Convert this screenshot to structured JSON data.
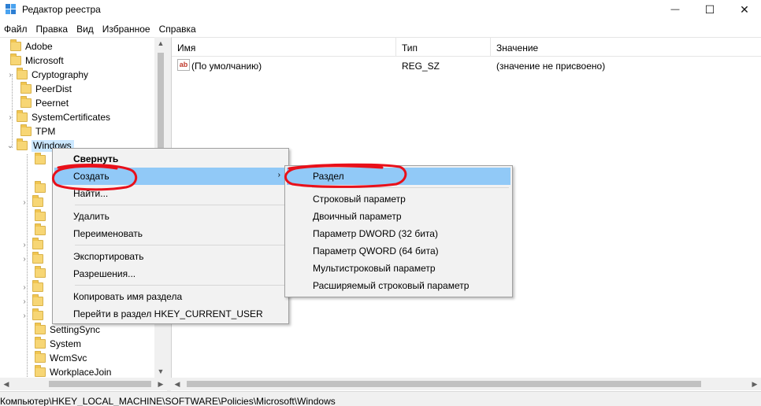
{
  "window": {
    "title": "Редактор реестра",
    "controls": {
      "minimize": "—",
      "maximize": "☐",
      "close": "✕"
    }
  },
  "menubar": [
    "Файл",
    "Правка",
    "Вид",
    "Избранное",
    "Справка"
  ],
  "tree": {
    "items": [
      {
        "label": "Adobe",
        "expander": ""
      },
      {
        "label": "Microsoft",
        "expander": ""
      },
      {
        "label": "Cryptography",
        "expander": "›"
      },
      {
        "label": "PeerDist",
        "expander": ""
      },
      {
        "label": "Peernet",
        "expander": ""
      },
      {
        "label": "SystemCertificates",
        "expander": "›"
      },
      {
        "label": "TPM",
        "expander": ""
      },
      {
        "label": "Windows",
        "expander": "⌄"
      },
      {
        "label": "SettingSync",
        "expander": ""
      },
      {
        "label": "System",
        "expander": ""
      },
      {
        "label": "WcmSvc",
        "expander": ""
      },
      {
        "label": "WorkplaceJoin",
        "expander": ""
      }
    ]
  },
  "list": {
    "columns": [
      "Имя",
      "Тип",
      "Значение"
    ],
    "rows": [
      {
        "icon": "ab",
        "name": "(По умолчанию)",
        "type": "REG_SZ",
        "value": "(значение не присвоено)"
      }
    ]
  },
  "context_menu": {
    "items": [
      {
        "label": "Свернуть"
      },
      {
        "label": "Создать",
        "submenu_arrow": "›"
      },
      {
        "label": "Найти..."
      },
      {
        "label": "Удалить"
      },
      {
        "label": "Переименовать"
      },
      {
        "label": "Экспортировать"
      },
      {
        "label": "Разрешения..."
      },
      {
        "label": "Копировать имя раздела"
      },
      {
        "label": "Перейти в раздел HKEY_CURRENT_USER"
      }
    ]
  },
  "submenu": {
    "items": [
      {
        "label": "Раздел"
      },
      {
        "label": "Строковый параметр"
      },
      {
        "label": "Двоичный параметр"
      },
      {
        "label": "Параметр DWORD (32 бита)"
      },
      {
        "label": "Параметр QWORD (64 бита)"
      },
      {
        "label": "Мультистроковый параметр"
      },
      {
        "label": "Расширяемый строковый параметр"
      }
    ]
  },
  "statusbar": {
    "path": "Компьютер\\HKEY_LOCAL_MACHINE\\SOFTWARE\\Policies\\Microsoft\\Windows"
  },
  "colors": {
    "highlight": "#91c9f7",
    "selection": "#cce8ff",
    "annotation": "#e8101a",
    "folder": "#f7d675"
  }
}
